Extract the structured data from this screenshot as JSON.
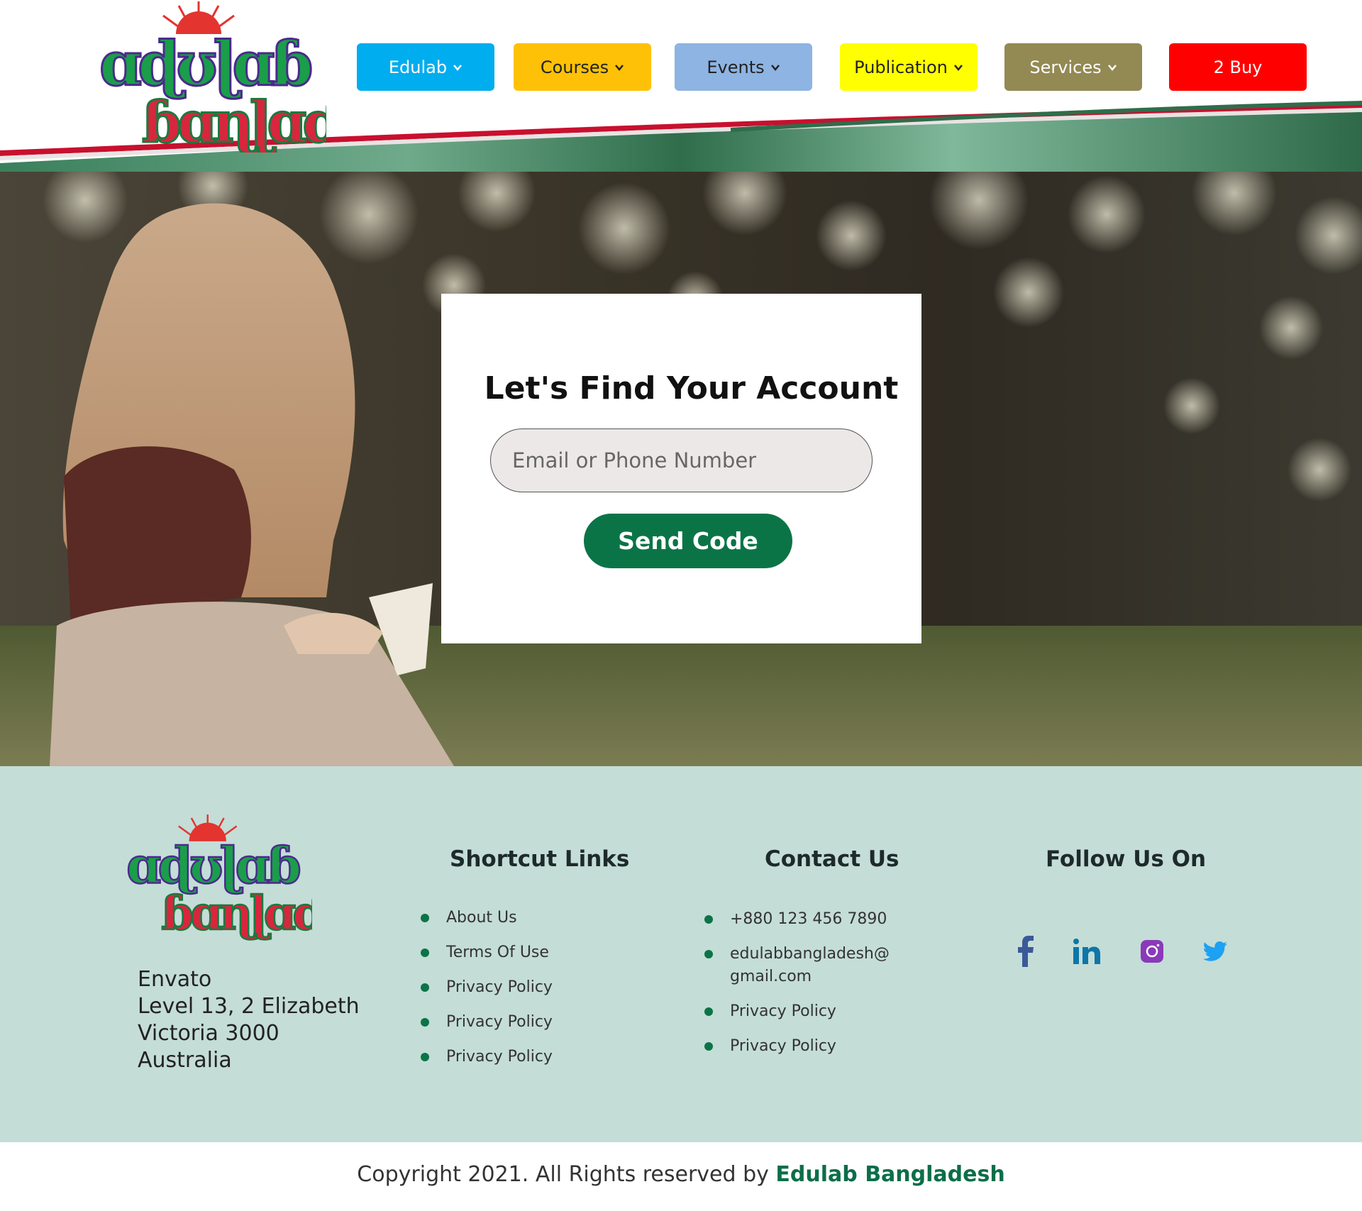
{
  "nav": {
    "items": [
      {
        "label": "Edulab",
        "has_dropdown": true,
        "color": "#00adee"
      },
      {
        "label": "Courses",
        "has_dropdown": true,
        "color": "#ffc107"
      },
      {
        "label": "Events",
        "has_dropdown": true,
        "color": "#8db4e2"
      },
      {
        "label": "Publication",
        "has_dropdown": true,
        "color": "#ffff00"
      },
      {
        "label": "Services",
        "has_dropdown": true,
        "color": "#938953"
      },
      {
        "label": "2 Buy",
        "has_dropdown": false,
        "color": "#ff0000"
      }
    ]
  },
  "card": {
    "title": "Let's Find Your Account",
    "input_placeholder": "Email or Phone Number",
    "input_value": "",
    "button_label": "Send Code",
    "button_color": "#0b7447"
  },
  "footer": {
    "address": {
      "line1": "Envato",
      "line2": "Level 13, 2 Elizabeth",
      "line3": "Victoria 3000",
      "line4": "Australia"
    },
    "shortcut_links": {
      "heading": "Shortcut Links",
      "items": [
        "About Us",
        "Terms Of Use",
        "Privacy Policy",
        "Privacy Policy",
        "Privacy Policy"
      ]
    },
    "contact": {
      "heading": "Contact Us",
      "phone": "+880 123 456 7890",
      "email_line1": "edulabbangladesh@",
      "email_line2": "gmail.com",
      "items": [
        "Privacy Policy",
        "Privacy Policy"
      ]
    },
    "follow": {
      "heading": "Follow Us On",
      "icons": [
        "facebook-icon",
        "linkedin-icon",
        "instagram-icon",
        "twitter-icon"
      ]
    },
    "background_color": "#c4ddd7"
  },
  "copyright": {
    "prefix": "Copyright 2021. All Rights reserved by ",
    "brand": "Edulab Bangladesh"
  }
}
